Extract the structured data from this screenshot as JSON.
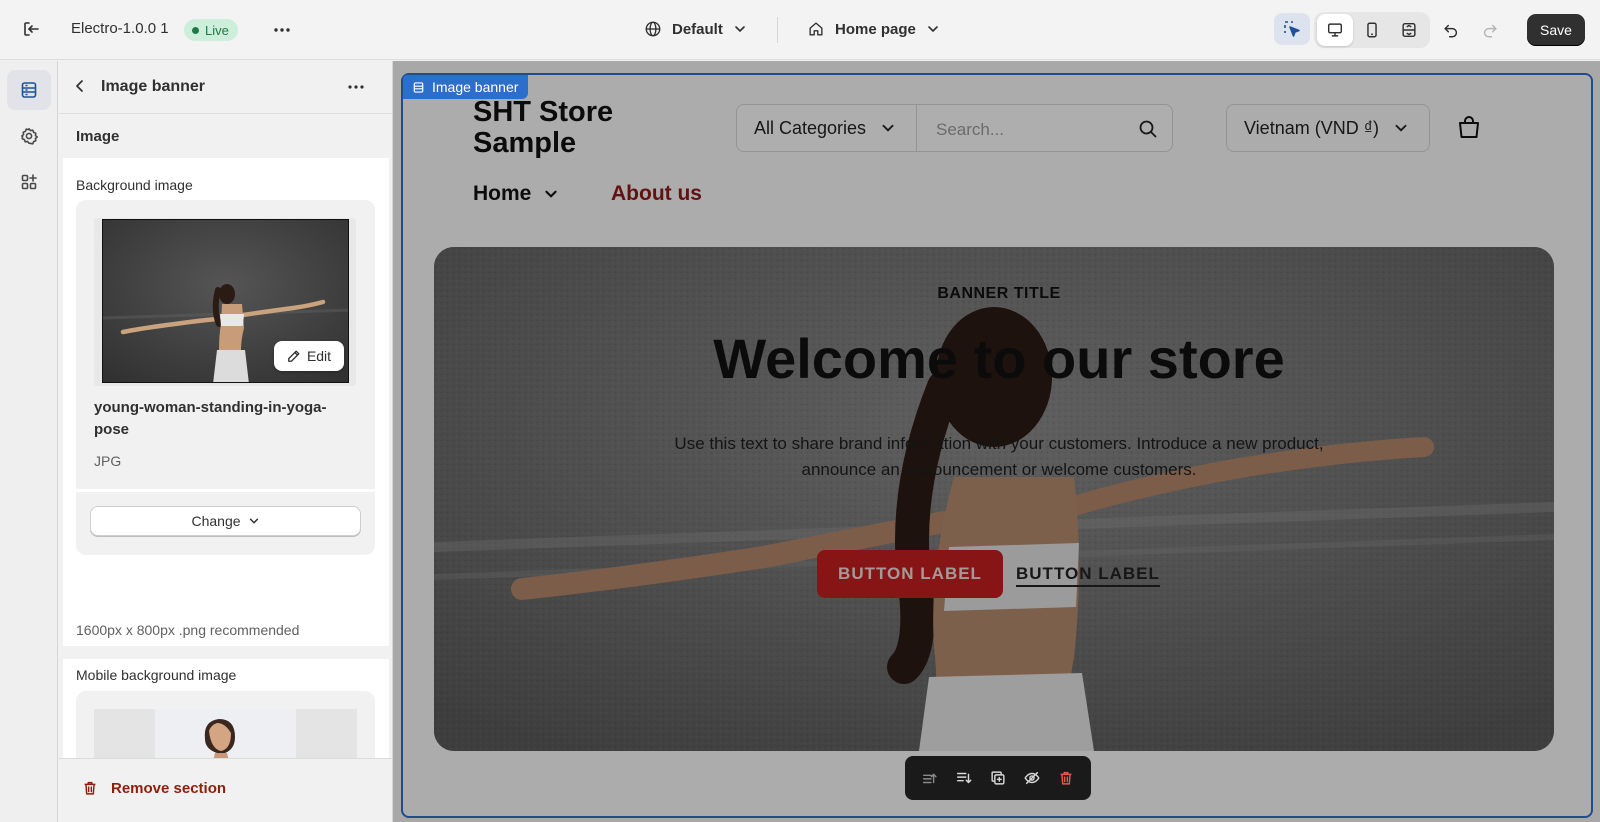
{
  "app": {
    "theme_name": "Electro-1.0.0 1",
    "live_badge": "Live",
    "save_label": "Save"
  },
  "topbar": {
    "theme_selector": "Default",
    "page_selector": "Home page"
  },
  "panel": {
    "back_title": "Image banner",
    "section_heading": "Image",
    "background_image": {
      "label": "Background image",
      "edit_label": "Edit",
      "file_name": "young-woman-standing-in-yoga-pose",
      "file_type": "JPG",
      "change_label": "Change",
      "hint": "1600px x 800px .png recommended"
    },
    "mobile_background_image": {
      "label": "Mobile background image"
    },
    "remove_section_label": "Remove section"
  },
  "preview": {
    "section_tag": "Image banner",
    "store_name_line1": "SHT Store",
    "store_name_line2": "Sample",
    "categories_label": "All Categories",
    "search_placeholder": "Search...",
    "currency_label": "Vietnam (VND ₫)",
    "nav": {
      "home": "Home",
      "about": "About us"
    },
    "banner": {
      "subtitle": "BANNER TITLE",
      "heading": "Welcome to our store",
      "text_line1": "Use this text to share brand information with your customers. Introduce a new product,",
      "text_line2": "announce an announcement or welcome customers.",
      "button_primary": "BUTTON LABEL",
      "button_secondary": "BUTTON LABEL"
    }
  },
  "colors": {
    "accent_blue": "#2c6ecb",
    "live_green": "#1e7a45",
    "about_red": "#8b1a1a",
    "primary_button_red": "#c21f1f",
    "remove_red": "#8e1f0b"
  }
}
